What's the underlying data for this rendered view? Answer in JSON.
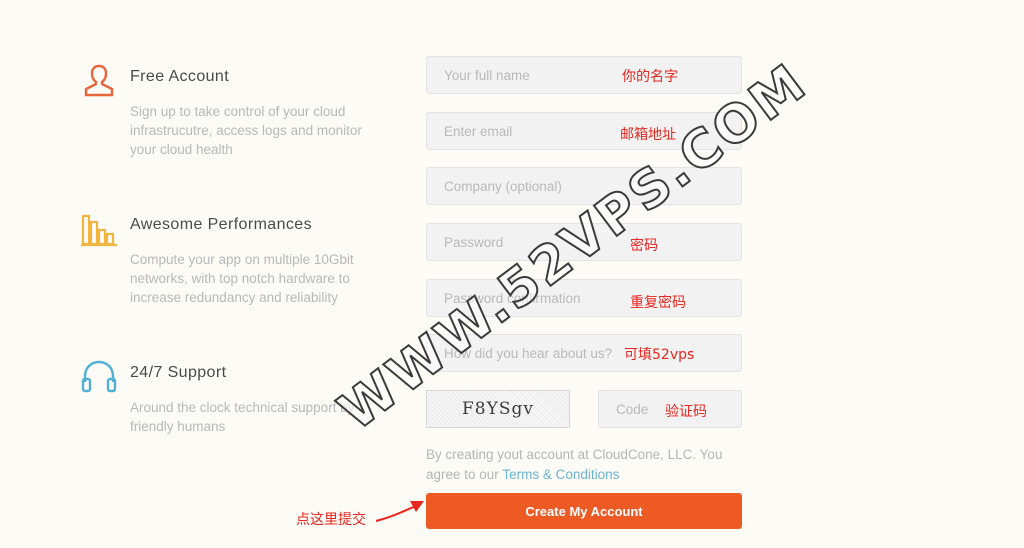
{
  "features": [
    {
      "icon": "user-icon",
      "title": "Free Account",
      "description": "Sign up to take control of your cloud infrastrucutre, access logs and monitor your cloud health"
    },
    {
      "icon": "bar-chart-icon",
      "title": "Awesome Performances",
      "description": "Compute your app on multiple 10Gbit networks, with top notch hardware to increase redundancy and reliability"
    },
    {
      "icon": "headphones-icon",
      "title": "24/7 Support",
      "description": "Around the clock technical support by friendly humans"
    }
  ],
  "form": {
    "full_name": {
      "placeholder": "Your full name",
      "value": ""
    },
    "email": {
      "placeholder": "Enter email",
      "value": ""
    },
    "company": {
      "placeholder": "Company (optional)",
      "value": ""
    },
    "password": {
      "placeholder": "Password",
      "value": ""
    },
    "password_confirm": {
      "placeholder": "Password confirmation",
      "value": ""
    },
    "referral": {
      "placeholder": "How did you hear about us?",
      "value": ""
    },
    "captcha_text": "F8YSgv",
    "code": {
      "placeholder": "Code",
      "value": ""
    },
    "terms_prefix": "By creating yout account at CloudCone, LLC. You agree to our",
    "terms_link": "Terms & Conditions",
    "submit_label": "Create My Account"
  },
  "annotations": {
    "full_name": "你的名字",
    "email": "邮箱地址",
    "password": "密码",
    "password_confirm": "重复密码",
    "referral": "可填52vps",
    "code": "验证码",
    "submit": "点这里提交"
  },
  "watermark": "WWW.52VPS.COM",
  "colors": {
    "accent": "#ee5a24",
    "icon_orange": "#e8643a",
    "icon_yellow": "#f2b640",
    "icon_blue": "#4fb0d6",
    "annotation_red": "#e8261f",
    "link_blue": "#6ab3d3"
  }
}
